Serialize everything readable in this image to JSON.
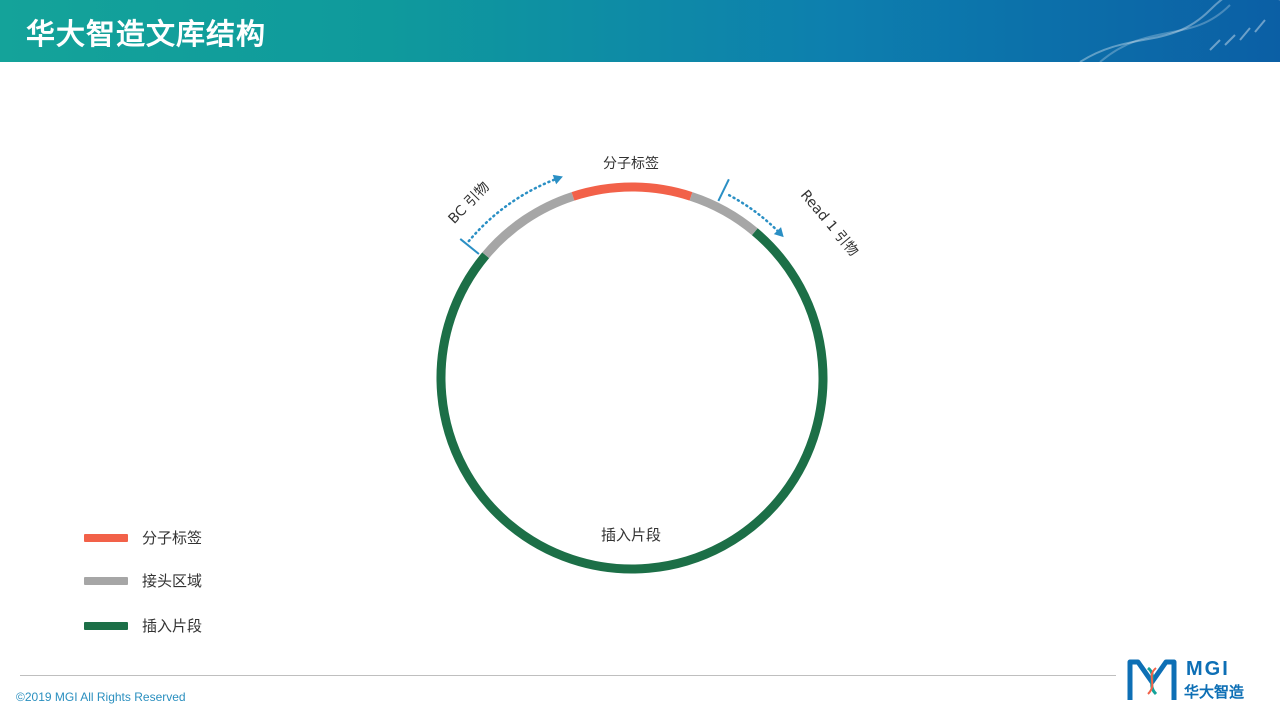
{
  "header": {
    "title": "华大智造文库结构"
  },
  "diagram": {
    "labels": {
      "molecular_tag": "分子标签",
      "insert": "插入片段",
      "bc_primer": "BC 引物",
      "read1_primer": "Read 1 引物"
    }
  },
  "legend": {
    "items": [
      {
        "label": "分子标签",
        "color": "#f26149"
      },
      {
        "label": "接头区域",
        "color": "#a6a6a6"
      },
      {
        "label": "插入片段",
        "color": "#1c6f47"
      }
    ]
  },
  "colors": {
    "molecular_tag": "#f26149",
    "adapter": "#a6a6a6",
    "insert": "#1c6f47",
    "primer_arrow": "#2a8fc4"
  },
  "footer": {
    "copyright": "©2019 MGI All Rights Reserved",
    "logo_text": "MGI",
    "logo_cn": "华大智造"
  }
}
